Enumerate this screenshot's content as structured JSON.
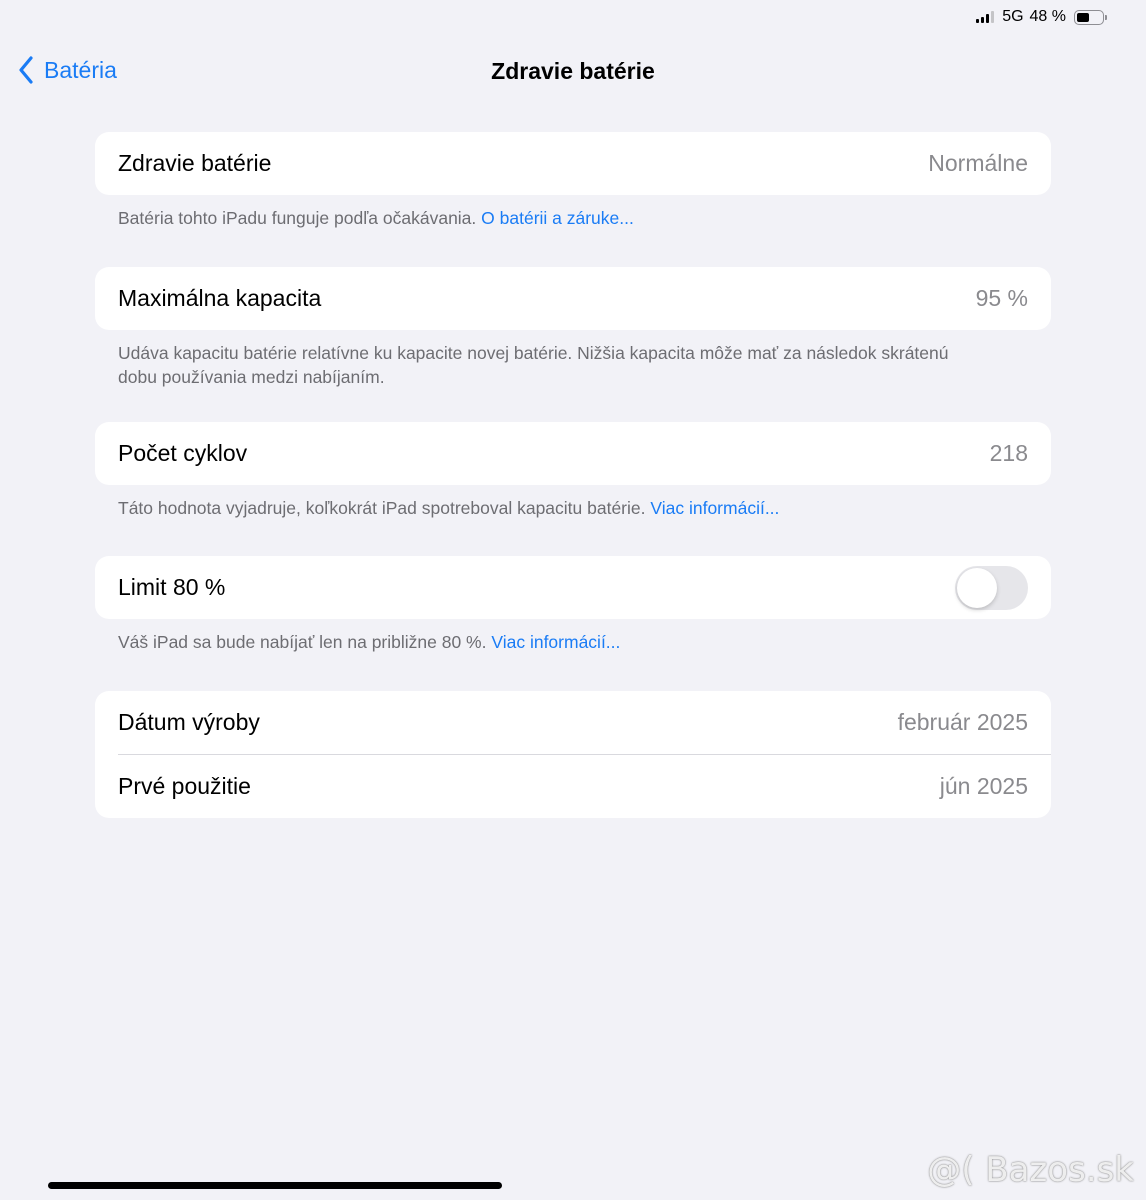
{
  "status_bar": {
    "network": "5G",
    "battery_percent_text": "48 %",
    "battery_level": 0.48
  },
  "nav": {
    "back_label": "Batéria",
    "title": "Zdravie batérie"
  },
  "sections": {
    "health": {
      "label": "Zdravie batérie",
      "value": "Normálne",
      "footer_text": "Batéria tohto iPadu funguje podľa očakávania.",
      "footer_link": "O batérii a záruke..."
    },
    "capacity": {
      "label": "Maximálna kapacita",
      "value": "95 %",
      "footer_text": "Udáva kapacitu batérie relatívne ku kapacite novej batérie. Nižšia kapacita môže mať za následok skrátenú dobu používania medzi nabíjaním."
    },
    "cycles": {
      "label": "Počet cyklov",
      "value": "218",
      "footer_text": "Táto hodnota vyjadruje, koľkokrát iPad spotreboval kapacitu batérie.",
      "footer_link": "Viac informácií..."
    },
    "limit": {
      "label": "Limit 80 %",
      "enabled": false,
      "footer_text": "Váš iPad sa bude nabíjať len na približne 80 %.",
      "footer_link": "Viac informácií..."
    },
    "dates": {
      "manufacture_label": "Dátum výroby",
      "manufacture_value": "február 2025",
      "first_use_label": "Prvé použitie",
      "first_use_value": "jún 2025"
    }
  },
  "watermark": "@( Bazos.sk",
  "colors": {
    "accent": "#1a7cf5",
    "background": "#f2f2f7",
    "secondary_text": "#8a8a8e"
  }
}
